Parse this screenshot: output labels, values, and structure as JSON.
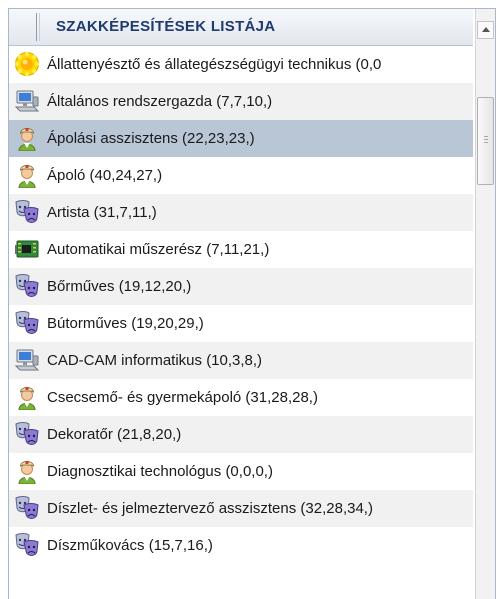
{
  "header": {
    "title": "SZAKKÉPESÍTÉSEK LISTÁJA"
  },
  "colors": {
    "selected_row": "#b9c6d5",
    "alt_row": "#f1f1f1",
    "header_text": "#1f3a6e"
  },
  "items": [
    {
      "label": "Állattenyésztő és állategészségügyi technikus (0,0",
      "icon": "sun-icon",
      "alt": false,
      "selected": false
    },
    {
      "label": "Általános rendszergazda (7,7,10,)",
      "icon": "computer-icon",
      "alt": true,
      "selected": false
    },
    {
      "label": "Ápolási asszisztens (22,23,23,)",
      "icon": "nurse-icon",
      "alt": false,
      "selected": true
    },
    {
      "label": "Ápoló (40,24,27,)",
      "icon": "nurse-icon",
      "alt": false,
      "selected": false
    },
    {
      "label": "Artista (31,7,11,)",
      "icon": "theater-masks-icon",
      "alt": true,
      "selected": false
    },
    {
      "label": "Automatikai műszerész (7,11,21,)",
      "icon": "circuit-board-icon",
      "alt": false,
      "selected": false
    },
    {
      "label": "Bőrműves (19,12,20,)",
      "icon": "theater-masks-icon",
      "alt": true,
      "selected": false
    },
    {
      "label": "Bútorműves (19,20,29,)",
      "icon": "theater-masks-icon",
      "alt": false,
      "selected": false
    },
    {
      "label": "CAD-CAM informatikus (10,3,8,)",
      "icon": "computer-icon",
      "alt": true,
      "selected": false
    },
    {
      "label": "Csecsemő- és gyermekápoló (31,28,28,)",
      "icon": "nurse-icon",
      "alt": false,
      "selected": false
    },
    {
      "label": "Dekoratőr (21,8,20,)",
      "icon": "theater-masks-icon",
      "alt": true,
      "selected": false
    },
    {
      "label": "Diagnosztikai technológus (0,0,0,)",
      "icon": "nurse-icon",
      "alt": false,
      "selected": false
    },
    {
      "label": "Díszlet- és jelmeztervező asszisztens (32,28,34,)",
      "icon": "theater-masks-icon",
      "alt": true,
      "selected": false
    },
    {
      "label": "Díszműkovács (15,7,16,)",
      "icon": "theater-masks-icon",
      "alt": false,
      "selected": false
    }
  ]
}
